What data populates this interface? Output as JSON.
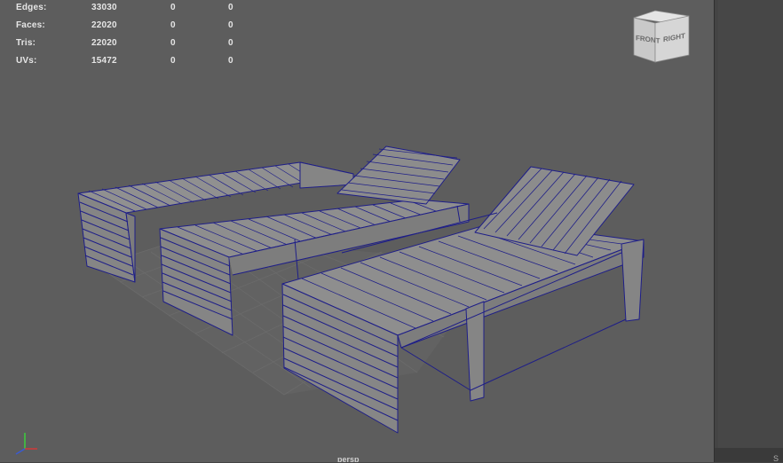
{
  "stats": {
    "rows": [
      {
        "label": "Edges:",
        "values": [
          "33030",
          "0",
          "0"
        ]
      },
      {
        "label": "Faces:",
        "values": [
          "22020",
          "0",
          "0"
        ]
      },
      {
        "label": "Tris:",
        "values": [
          "22020",
          "0",
          "0"
        ]
      },
      {
        "label": "UVs:",
        "values": [
          "15472",
          "0",
          "0"
        ]
      }
    ]
  },
  "view_cube": {
    "front_label": "FRONT",
    "right_label": "RIGHT"
  },
  "camera_label": "persp",
  "right_panel_text": "S",
  "colors": {
    "viewport_bg": "#5d5d5d",
    "wireframe": "#1e1e88",
    "model_fill": "#8a8a8a",
    "grid": "#6b6b6b",
    "hud_text": "#e6e6e6",
    "axis_x": "#d23a3a",
    "axis_y": "#3ccf3c",
    "axis_z": "#3a5ad2"
  }
}
